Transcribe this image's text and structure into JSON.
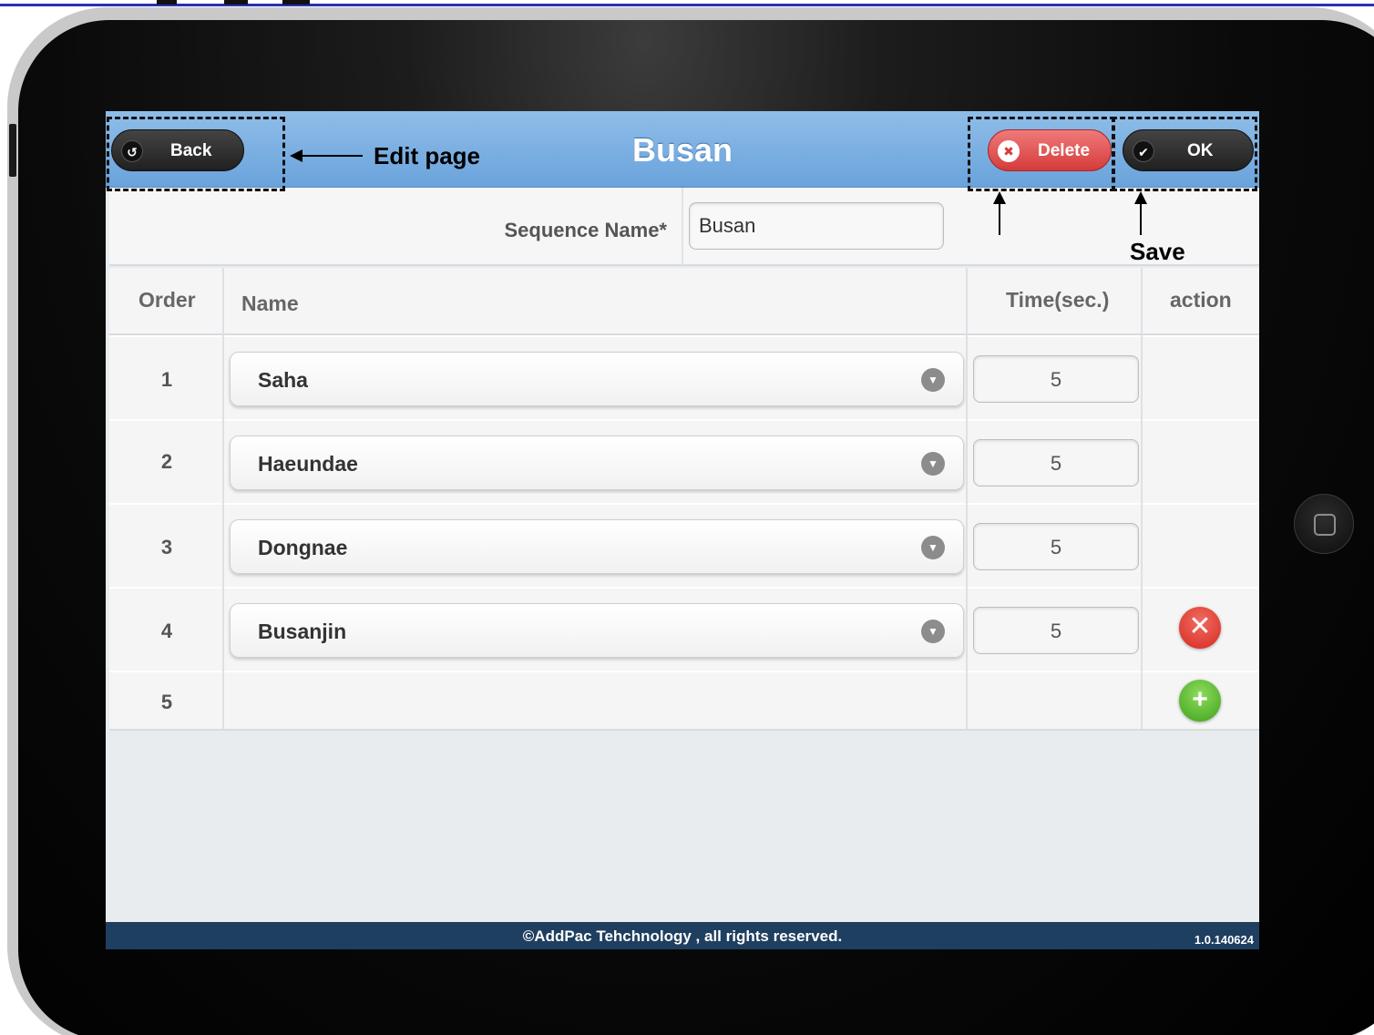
{
  "header": {
    "title": "Busan",
    "back_label": "Back",
    "delete_label": "Delete",
    "ok_label": "OK"
  },
  "form": {
    "sequence_label": "Sequence Name*",
    "sequence_value": "Busan"
  },
  "table": {
    "columns": [
      "Order",
      "Name",
      "Time(sec.)",
      "action"
    ],
    "rows": [
      {
        "order": "1",
        "name": "Saha",
        "time": "5"
      },
      {
        "order": "2",
        "name": "Haeundae",
        "time": "5"
      },
      {
        "order": "3",
        "name": "Dongnae",
        "time": "5"
      },
      {
        "order": "4",
        "name": "Busanjin",
        "time": "5"
      }
    ],
    "new_row_order": "5"
  },
  "footer": {
    "copyright": "©AddPac Tehchnology , all rights reserved.",
    "version": "1.0.140624"
  },
  "annotations": {
    "edit_page": "Edit page",
    "save": "Save"
  },
  "icons": {
    "back": "back-arrow-icon",
    "delete": "close-circle-icon",
    "ok": "checkmark-icon",
    "dropdown": "chevron-down-icon",
    "remove_row": "remove-row-icon",
    "add_row": "add-row-icon"
  },
  "colors": {
    "header": "#7fb2e4",
    "delete": "#d53b3b",
    "footer": "#1f3f60",
    "remove": "#d42a22",
    "add": "#3ea11e"
  }
}
